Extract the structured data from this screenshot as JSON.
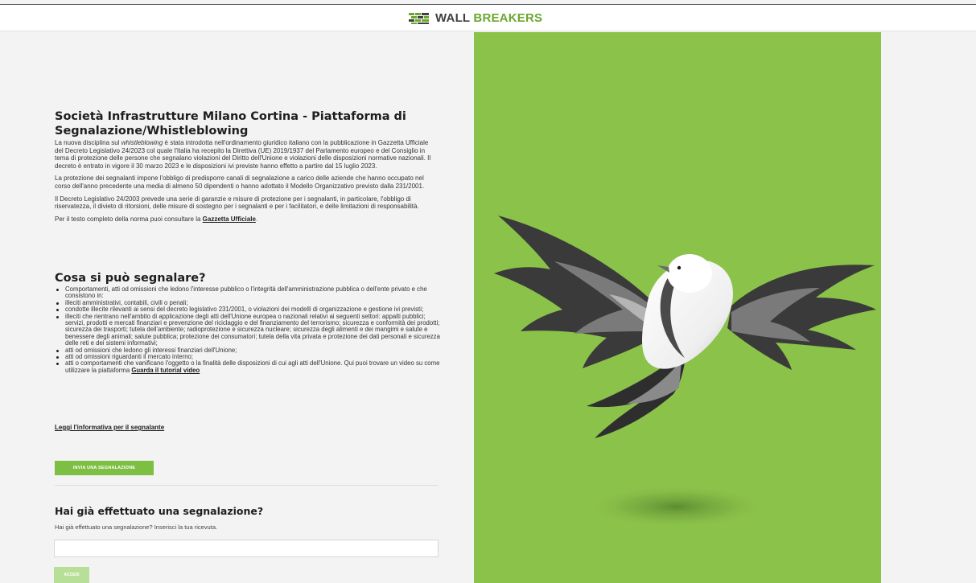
{
  "header": {
    "brand_part1": "WALL",
    "brand_part2": "BREAKERS",
    "logo_icon": "wall-breakers-logo-icon"
  },
  "main": {
    "title": "Società Infrastrutture Milano Cortina - Piattaforma di Segnalazione/Whistleblowing",
    "para1_prefix": "La nuova disciplina sul ",
    "para1_em": "whistleblowing",
    "para1_rest": " è stata introdotta nell'ordinamento giuridico italiano con la pubblicazione in Gazzetta Ufficiale del Decreto Legislativo 24/2023 col quale l'Italia ha recepito la Direttiva (UE) 2019/1937 del Parlamento europeo e del Consiglio in tema di protezione delle persone che segnalano violazioni del Diritto dell'Unione e violazioni delle disposizioni normative nazionali. Il decreto è entrato in vigore il 30 marzo 2023 e le disposizioni ivi previste hanno effetto a partire dal 15 luglio 2023.",
    "para2": "La protezione dei segnalanti impone l'obbligo di predisporre canali di segnalazione a carico delle aziende che hanno occupato nel corso dell'anno precedente una media di almeno 50 dipendenti o hanno adottato il Modello Organizzativo previsto dalla 231/2001.",
    "para3": "Il Decreto Legislativo 24/2003 prevede una serie di garanzie e misure di protezione per i segnalanti, in particolare, l'obbligo di riservatezza, il divieto di ritorsioni, delle misure di sostegno per i segnalanti e per i facilitatori, e delle limitazioni di responsabilità.",
    "para4_prefix": "Per il testo completo della norma puoi consultare la ",
    "para4_link": "Gazzetta Ufficiale",
    "para4_suffix": ".",
    "what_heading": "Cosa si può segnalare?",
    "items": [
      "Comportamenti, atti od omissioni che ledono l'interesse pubblico o l'integrità dell'amministrazione pubblica o dell'ente privato e che consistono in:",
      "illeciti amministrativi, contabili, civili o penali;",
      "condotte illecite rilevanti ai sensi del decreto legislativo 231/2001, o violazioni dei modelli di organizzazione e gestione ivi previsti;",
      "illeciti che rientrano nell'ambito di applicazione degli atti dell'Unione europea o nazionali relativi ai seguenti settori: appalti pubblici; servizi, prodotti e mercati finanziari e prevenzione del riciclaggio e del finanziamento del terrorismo; sicurezza e conformità dei prodotti; sicurezza dei trasporti; tutela dell'ambiente; radioprotezione e sicurezza nucleare; sicurezza degli alimenti e dei mangimi e salute e benessere degli animali; salute pubblica; protezione dei consumatori; tutela della vita privata e protezione dei dati personali e sicurezza delle reti e dei sistemi informativi;",
      "atti od omissioni che ledono gli interessi finanziari dell'Unione;",
      "atti od omissioni riguardanti il mercato interno;"
    ],
    "last_item_text": "atti o comportamenti che vanificano l'oggetto o la finalità delle disposizioni di cui agli atti dell'Unione. Qui puoi trovare un video su come utilizzare la piattaforma ",
    "last_item_link": "Guarda il tutorial video",
    "info_link": "Leggi l'informativa per il segnalante",
    "submit_button": "INVIA UNA SEGNALAZIONE",
    "already_heading": "Hai già effettuato una segnalazione?",
    "already_sub": "Hai già effettuato una segnalazione? Inserisci la tua ricevuta.",
    "receipt_value": "",
    "access_button": "ACCEDI"
  },
  "colors": {
    "brand_green": "#6aa72e",
    "panel_green": "#8bc24a",
    "button_green": "#7cbf43",
    "button_disabled": "#b8df97"
  },
  "illustration": {
    "icon": "flying-bird-illustration"
  }
}
